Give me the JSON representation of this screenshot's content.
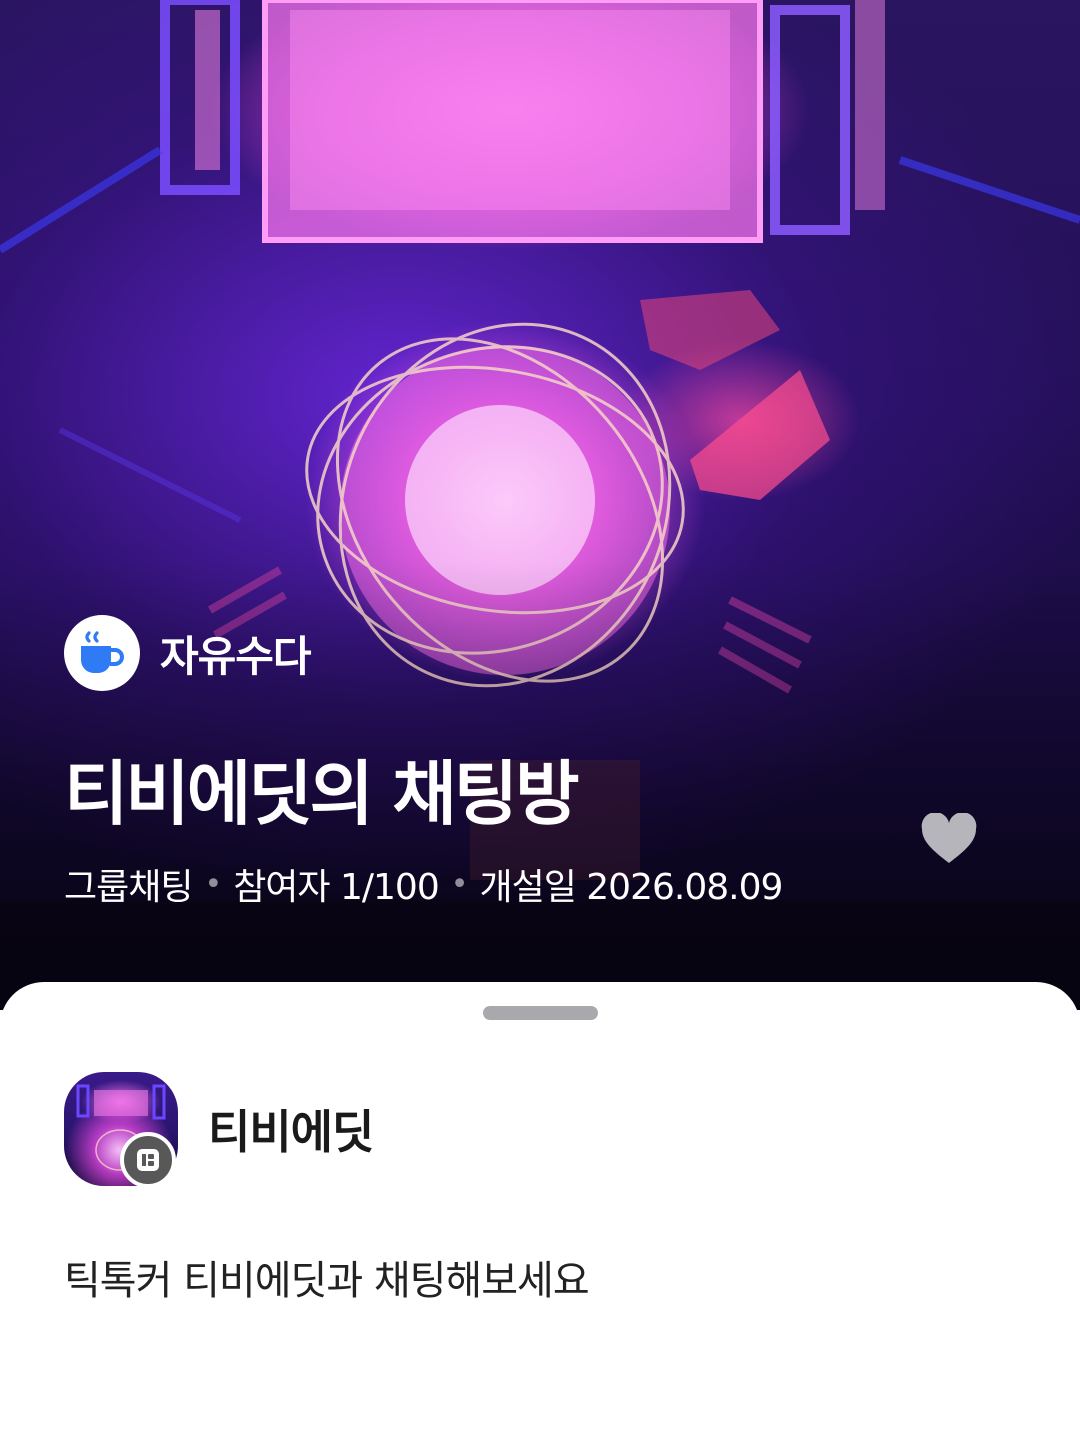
{
  "hero": {
    "category": {
      "icon": "coffee-cup-icon",
      "label": "자유수다",
      "icon_color": "#2f7bf5"
    },
    "title": "티비에딧의 채팅방",
    "meta": {
      "type": "그룹채팅",
      "participants": "참여자 1/100",
      "created": "개설일 2026.08.09"
    },
    "like_icon": "heart-icon"
  },
  "sheet": {
    "owner": {
      "name": "티비에딧",
      "badge_icon": "host-badge-icon"
    },
    "description": "틱톡커 티비에딧과 채팅해보세요"
  }
}
